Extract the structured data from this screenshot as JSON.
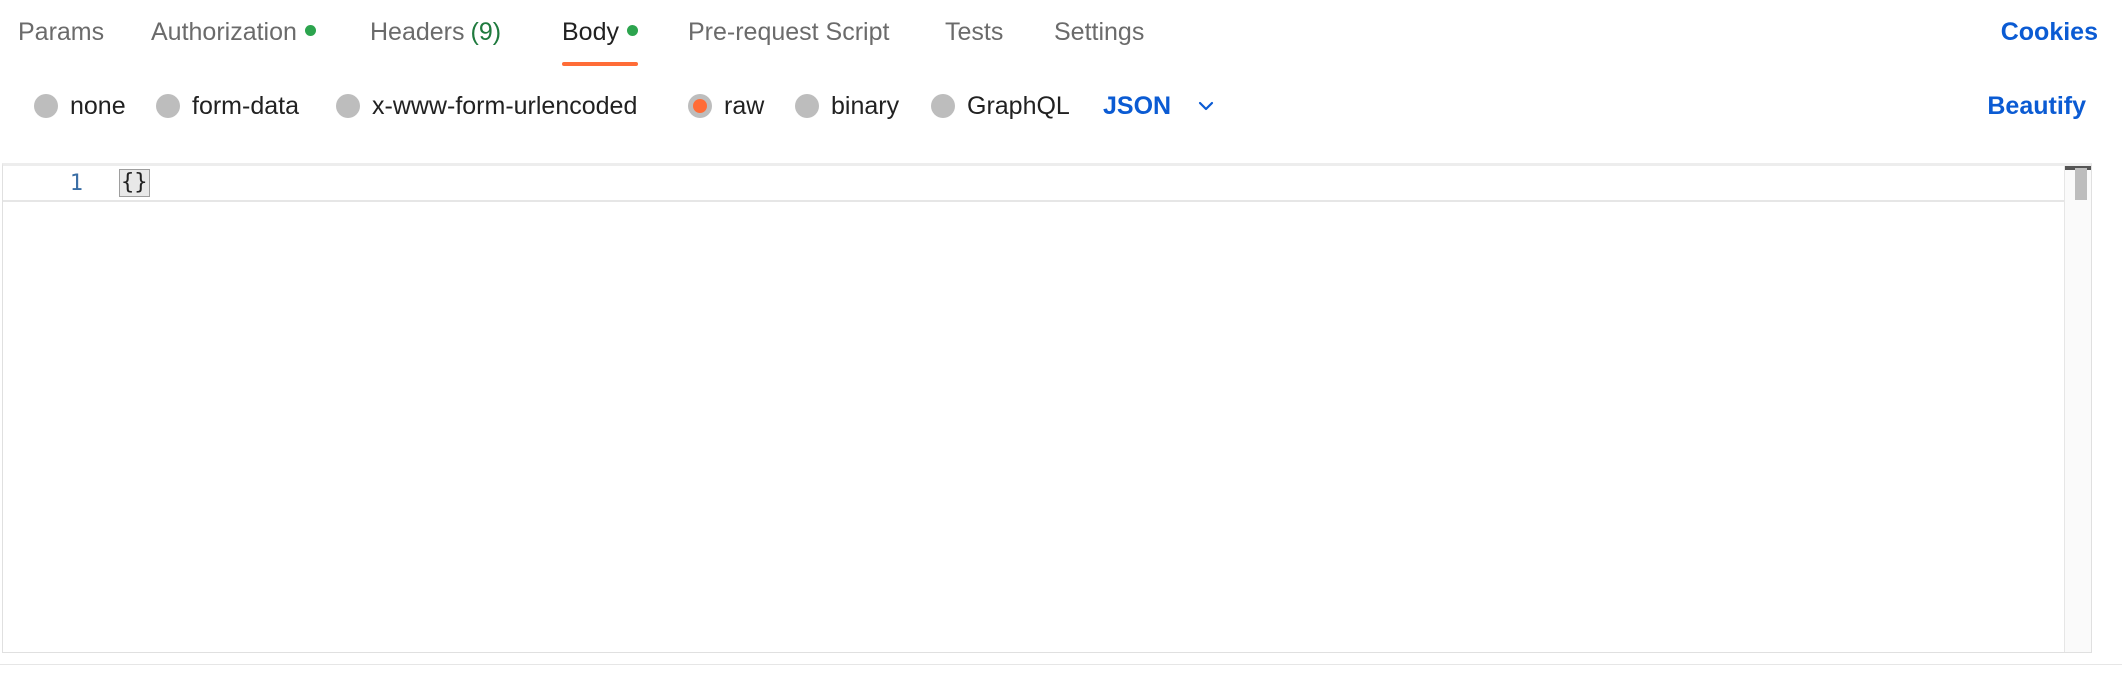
{
  "colors": {
    "accent": "#ff6c37",
    "link_blue": "#0b5bd3",
    "dot_green": "#2ca44e",
    "count_green": "#1f7a3e"
  },
  "tabs": [
    {
      "label": "Params",
      "count": "",
      "has_dot": false,
      "active": false
    },
    {
      "label": "Authorization",
      "count": "",
      "has_dot": true,
      "active": false
    },
    {
      "label": "Headers",
      "count": "(9)",
      "has_dot": false,
      "active": false
    },
    {
      "label": "Body",
      "count": "",
      "has_dot": true,
      "active": true
    },
    {
      "label": "Pre-request Script",
      "count": "",
      "has_dot": false,
      "active": false
    },
    {
      "label": "Tests",
      "count": "",
      "has_dot": false,
      "active": false
    },
    {
      "label": "Settings",
      "count": "",
      "has_dot": false,
      "active": false
    }
  ],
  "cookies_label": "Cookies",
  "body_types": [
    {
      "label": "none",
      "selected": false
    },
    {
      "label": "form-data",
      "selected": false
    },
    {
      "label": "x-www-form-urlencoded",
      "selected": false
    },
    {
      "label": "raw",
      "selected": true
    },
    {
      "label": "binary",
      "selected": false
    },
    {
      "label": "GraphQL",
      "selected": false
    }
  ],
  "language_select": {
    "value": "JSON",
    "icon": "chevron-down-icon"
  },
  "beautify_label": "Beautify",
  "editor": {
    "lines": [
      {
        "number": "1",
        "text": "{}"
      }
    ]
  }
}
